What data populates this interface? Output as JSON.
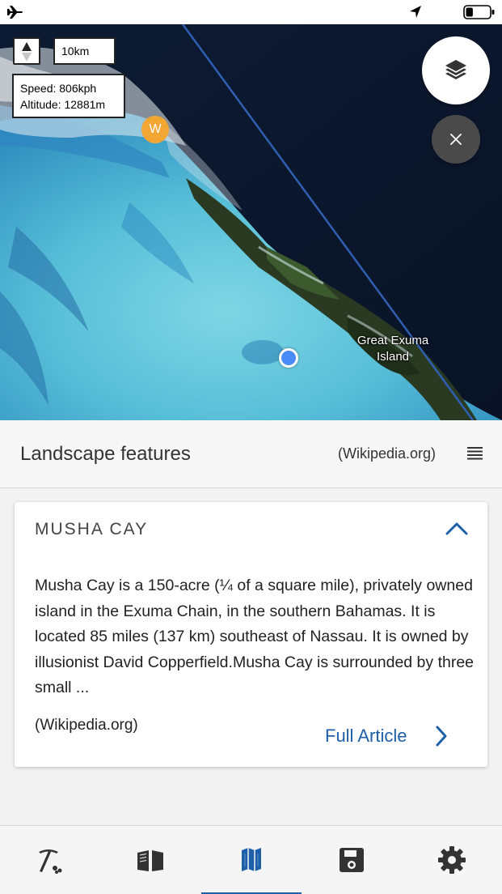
{
  "status_bar": {
    "icons": [
      "airplane-icon",
      "location-arrow-icon",
      "battery-icon"
    ],
    "battery_level": 0.3
  },
  "map": {
    "scale_label": "10km",
    "speed_text": "Speed: 806kph",
    "altitude_text": "Altitude: 12881m",
    "poi_marker_letter": "W",
    "place_label": "Great Exuma Island",
    "colors": {
      "poi_marker": "#f2a735",
      "user_location": "#4a8cf7",
      "flight_path": "#2f5fb0"
    }
  },
  "section": {
    "title": "Landscape features",
    "source": "(Wikipedia.org)"
  },
  "card": {
    "title": "MUSHA CAY",
    "text": "Musha Cay is a 150-acre (¼ of a square mile), privately owned island in the Exuma Chain, in the southern Bahamas. It is located 85 miles (137 km) southeast of Nassau. It is owned by illusionist David Copperfield.Musha Cay is surrounded by three small ...",
    "source": "(Wikipedia.org)",
    "link_label": "Full Article"
  },
  "bottom_nav": {
    "items": [
      {
        "icon": "pickaxe-icon",
        "active": false
      },
      {
        "icon": "book-icon",
        "active": false
      },
      {
        "icon": "map-icon",
        "active": true
      },
      {
        "icon": "save-icon",
        "active": false
      },
      {
        "icon": "gear-icon",
        "active": false
      }
    ],
    "accent_color": "#1d5fa8"
  }
}
